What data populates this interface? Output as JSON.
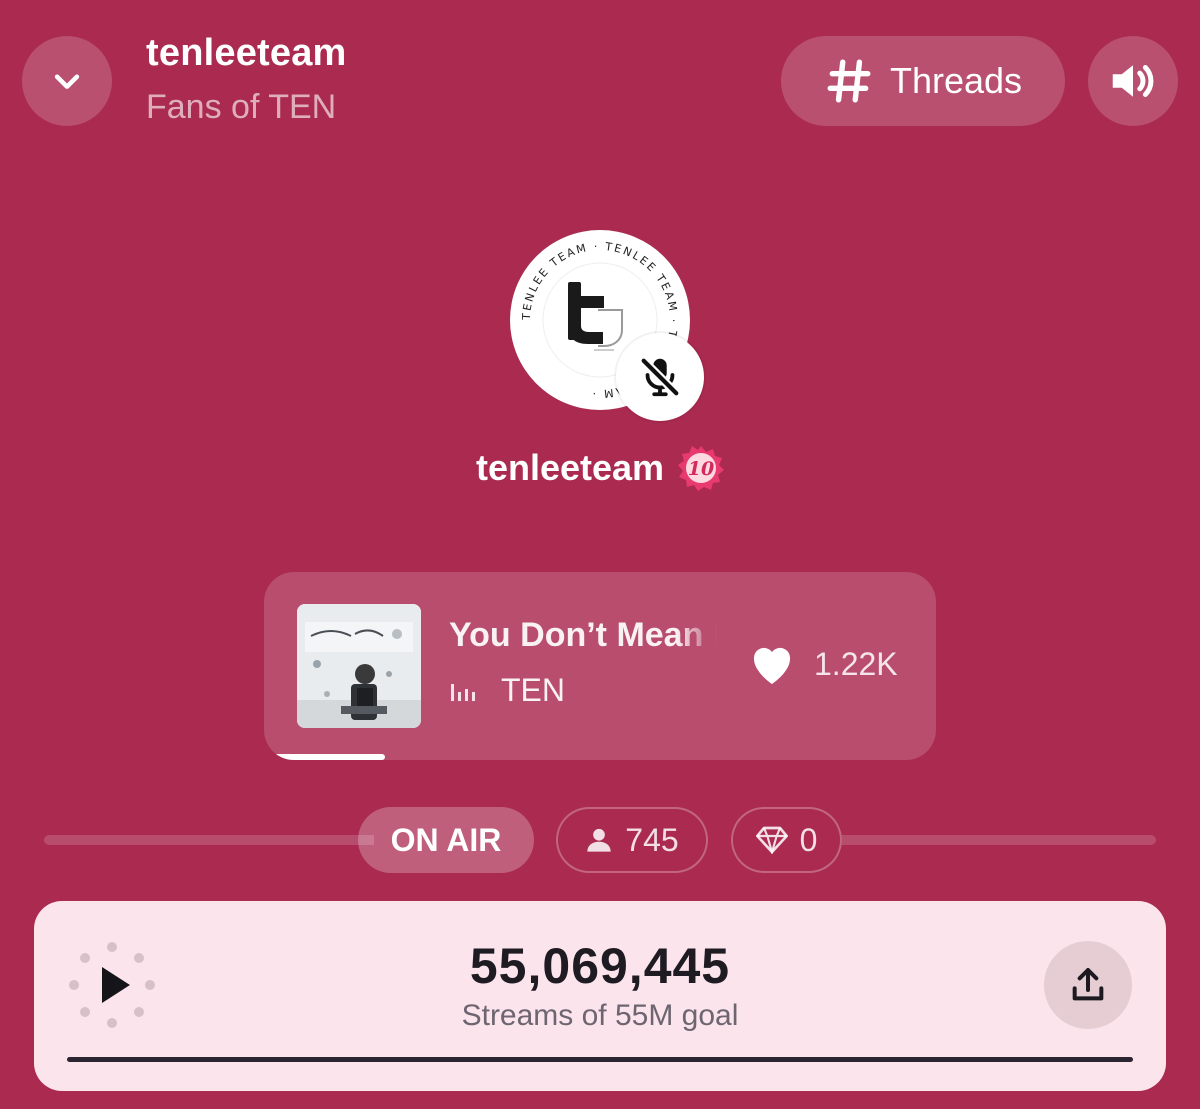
{
  "header": {
    "room_title": "tenleeteam",
    "room_subtitle": "Fans of TEN",
    "threads_label": "Threads"
  },
  "host": {
    "name": "tenleeteam",
    "avatar_ring_text": "TENLEE TEAM · TENLEE TEAM · TENLEE TEAM ·",
    "badge_text": "10",
    "muted": true
  },
  "now_playing": {
    "title": "You Don’t Mean It",
    "artist": "TEN",
    "likes": "1.22K",
    "progress": 0.18
  },
  "status": {
    "on_air_label": "ON AIR",
    "listeners": "745",
    "gems": "0"
  },
  "goal": {
    "count": "55,069,445",
    "caption": "Streams of 55M goal",
    "progress": 1.0
  },
  "colors": {
    "background": "#aa2a50",
    "panel": "#fce4ec",
    "badge": "#e83a6e"
  }
}
